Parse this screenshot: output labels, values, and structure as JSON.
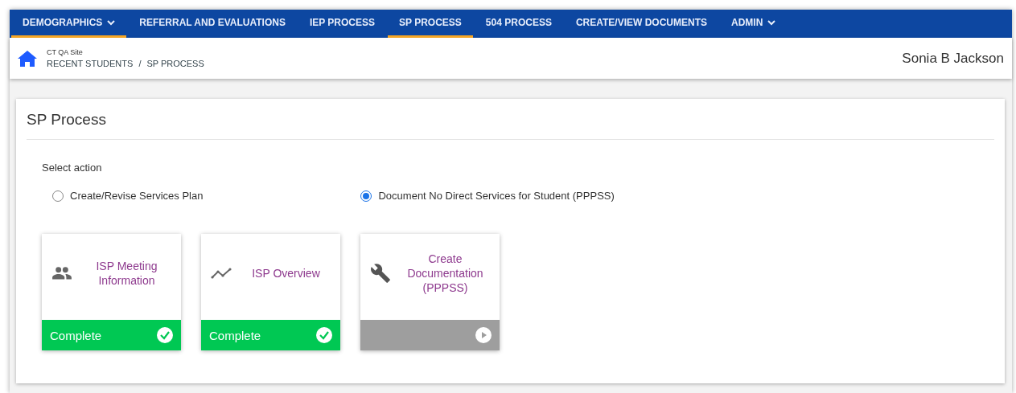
{
  "nav": [
    {
      "label": "DEMOGRAPHICS",
      "selected": true,
      "dropdown": true
    },
    {
      "label": "REFERRAL AND EVALUATIONS",
      "selected": false,
      "dropdown": false
    },
    {
      "label": "IEP PROCESS",
      "selected": false,
      "dropdown": false
    },
    {
      "label": "SP PROCESS",
      "selected": true,
      "dropdown": false
    },
    {
      "label": "504 PROCESS",
      "selected": false,
      "dropdown": false
    },
    {
      "label": "CREATE/VIEW DOCUMENTS",
      "selected": false,
      "dropdown": false
    },
    {
      "label": "ADMIN",
      "selected": false,
      "dropdown": true
    }
  ],
  "header": {
    "site": "CT QA Site",
    "breadcrumb": [
      "RECENT STUDENTS",
      "SP PROCESS"
    ],
    "separator": "/",
    "student": "Sonia B Jackson"
  },
  "panel": {
    "title": "SP Process",
    "prompt": "Select action",
    "options": [
      {
        "label": "Create/Revise Services Plan",
        "selected": false
      },
      {
        "label": "Document No Direct Services for Student (PPPSS)",
        "selected": true
      }
    ],
    "tiles": [
      {
        "kind": "people",
        "title": "ISP Meeting Information",
        "complete": true,
        "status_label": "Complete"
      },
      {
        "kind": "chart",
        "title": "ISP Overview",
        "complete": true,
        "status_label": "Complete"
      },
      {
        "kind": "wrench",
        "title": "Create Documentation (PPPSS)",
        "complete": false
      }
    ]
  }
}
